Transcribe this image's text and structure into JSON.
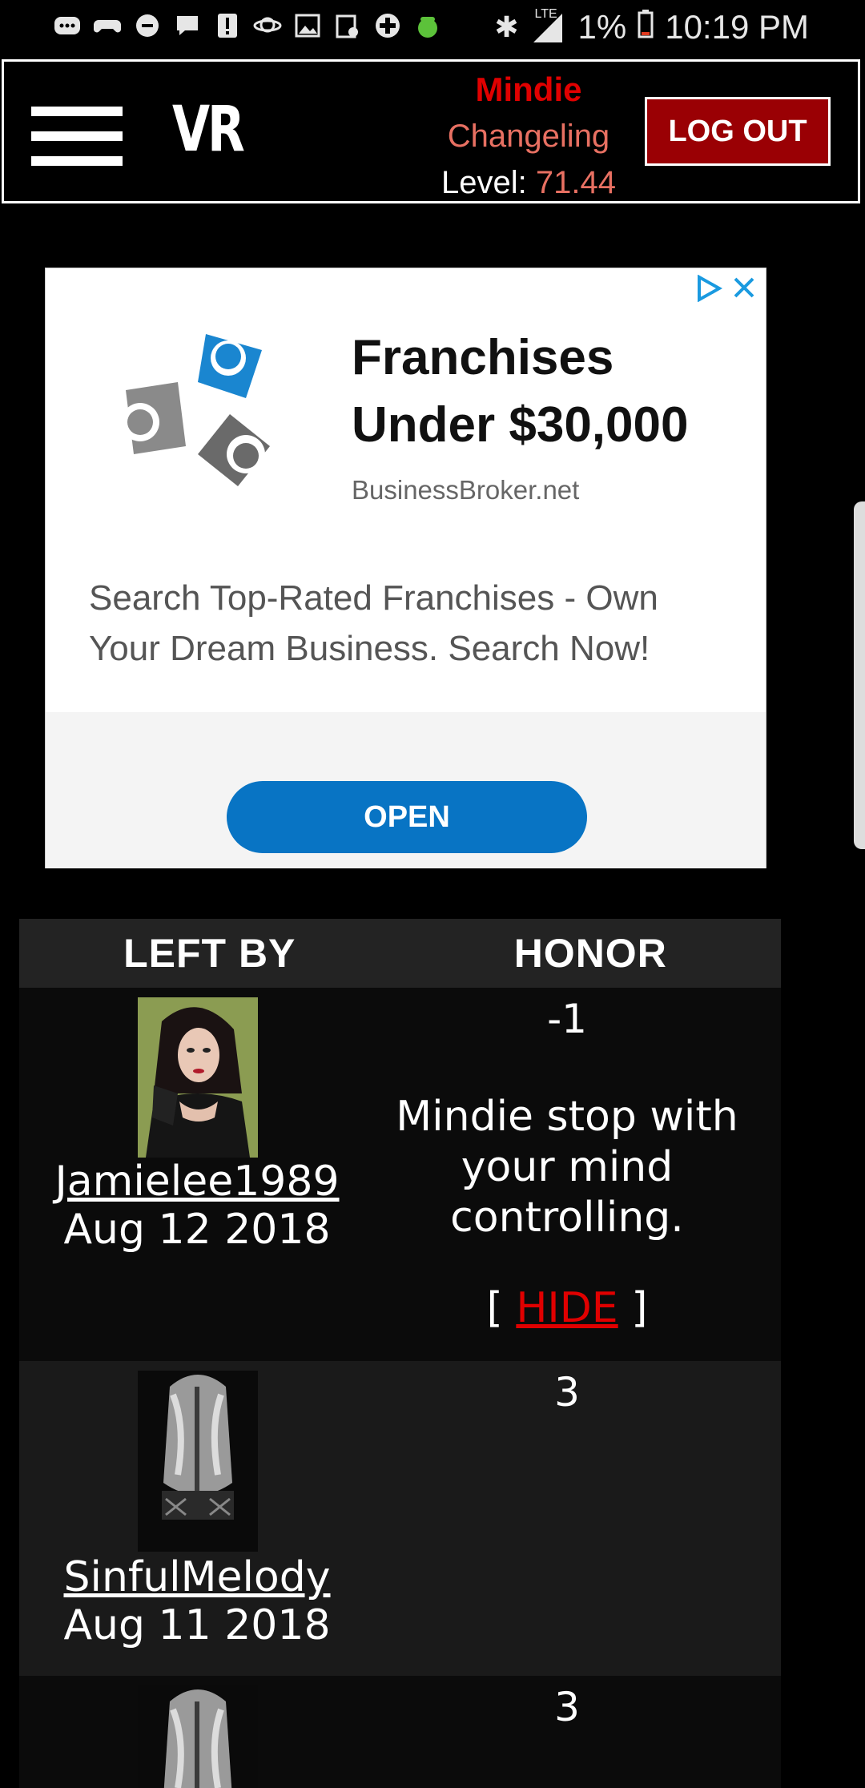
{
  "status_bar": {
    "signal": "LTE",
    "battery": "1%",
    "time": "10:19 PM"
  },
  "header": {
    "logo": "VR",
    "user": {
      "name": "Mindie",
      "class": "Changeling",
      "level_label": "Level:",
      "level_value": "71.44"
    },
    "logout_label": "LOG OUT"
  },
  "ad": {
    "title": "Franchises Under $30,000",
    "domain": "BusinessBroker.net",
    "description": "Search Top-Rated Franchises - Own Your Dream Business. Search Now!",
    "button_label": "OPEN",
    "accent_color": "#0874c4"
  },
  "honor_table": {
    "headers": [
      "LEFT BY",
      "HONOR"
    ],
    "rows": [
      {
        "username": "Jamielee1989",
        "date": "Aug 12 2018",
        "score": "-1",
        "comment": "Mindie stop with your mind controlling.",
        "hide_label": "HIDE"
      },
      {
        "username": "SinfulMelody",
        "date": "Aug 11 2018",
        "score": "3"
      },
      {
        "score": "3"
      }
    ]
  }
}
